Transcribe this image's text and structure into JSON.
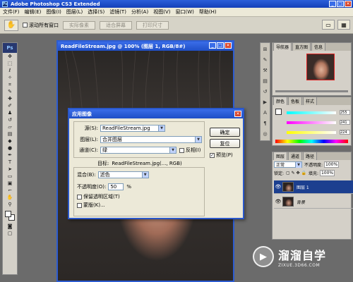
{
  "app": {
    "title": "Adobe Photoshop CS3 Extended",
    "logo": "Ps"
  },
  "window_controls": {
    "minimize": "_",
    "maximize": "□",
    "close": "✕"
  },
  "menu": [
    "文件(F)",
    "编辑(E)",
    "图像(I)",
    "图层(L)",
    "选择(S)",
    "滤镜(T)",
    "分析(A)",
    "视图(V)",
    "窗口(W)",
    "帮助(H)"
  ],
  "options_bar": {
    "scroll_all_label": "滚动所有窗口",
    "actual_pixels": "实际像素",
    "fit_screen": "适合屏幕",
    "print_size": "打印尺寸"
  },
  "document": {
    "title": "ReadFileStream.jpg @ 100% (图层 1, RGB/8#)"
  },
  "dialog": {
    "title": "应用图像",
    "source_label": "源(S):",
    "source_value": "ReadFileStream.jpg",
    "layer_label": "图层(L):",
    "layer_value": "合并图层",
    "channel_label": "通道(C):",
    "channel_value": "绿",
    "invert_label": "反相(I)",
    "target_label": "目标:",
    "target_value": "ReadFileStream.jpg(..., RGB)",
    "blending_label": "混合(B):",
    "blending_value": "滤色",
    "opacity_label": "不透明度(O):",
    "opacity_value": "50",
    "opacity_unit": "%",
    "preserve_label": "保留透明区域(T)",
    "mask_label": "蒙版(K)...",
    "ok": "确定",
    "reset": "复位",
    "preview_label": "预览(P)",
    "preview_checked": true
  },
  "panels": {
    "navigator_tabs": [
      "导航器",
      "直方图",
      "信息"
    ],
    "color_tabs": [
      "颜色",
      "色板",
      "样式"
    ],
    "color_values": [
      "255",
      "241",
      "224"
    ],
    "layers_tabs": [
      "图层",
      "通道",
      "路径"
    ],
    "blend_mode": "正常",
    "opacity_label": "不透明度:",
    "opacity_value": "100%",
    "lock_label": "锁定:",
    "fill_label": "填充:",
    "fill_value": "100%",
    "layers": [
      {
        "name": "图层 1",
        "selected": true
      },
      {
        "name": "背景",
        "selected": false
      }
    ]
  },
  "watermark": {
    "name": "溜溜自学",
    "url": "ZIXUE.3D66.COM"
  },
  "colors": {
    "title_blue": "#2050c8",
    "selection_blue": "#1c3f8f",
    "dialog_bg": "#ece9d8"
  }
}
